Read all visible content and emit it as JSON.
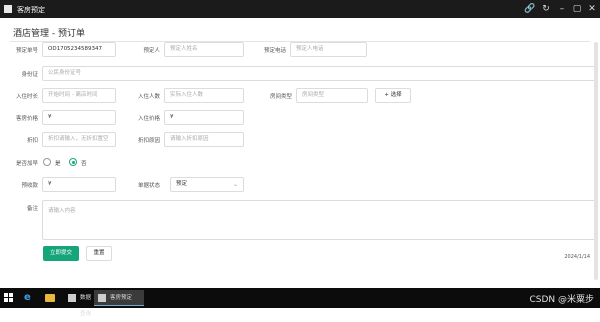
{
  "window": {
    "title": "客房预定",
    "controls": [
      "🔗",
      "↻",
      "–",
      "▢",
      "✕"
    ]
  },
  "page": {
    "title": "酒店管理 - 预订单"
  },
  "form": {
    "booking_no": {
      "label": "预定单号",
      "value": "OD1705234589347"
    },
    "booker": {
      "label": "预定人",
      "placeholder": "预定人姓名"
    },
    "booker_phone": {
      "label": "预定电话",
      "placeholder": "预定人电话"
    },
    "id_card": {
      "label": "身份证",
      "placeholder": "公民身份证号"
    },
    "checkin_time": {
      "label": "入住时长",
      "placeholder": "开始时间 - 离店时间"
    },
    "guests": {
      "label": "入住人数",
      "placeholder": "实际入住人数"
    },
    "room_type": {
      "label": "房间类型",
      "placeholder": "房间类型",
      "select_button": "+ 选择"
    },
    "price": {
      "label": "客房价格",
      "value": "¥"
    },
    "checkin_price": {
      "label": "入住价格",
      "value": "¥"
    },
    "discount": {
      "label": "折扣",
      "placeholder": "折扣请输入，无折扣置空"
    },
    "discount_reason": {
      "label": "折扣原因",
      "placeholder": "请输入折扣原因"
    },
    "breakfast": {
      "label": "是否加早",
      "options": [
        "是",
        "否"
      ],
      "selected": "否"
    },
    "deposit": {
      "label": "预收款",
      "value": "¥"
    },
    "status": {
      "label": "单据状态",
      "value": "预定"
    },
    "remark": {
      "label": "备注",
      "placeholder": "请输入内容"
    }
  },
  "actions": {
    "submit": "立即提交",
    "reset": "重置"
  },
  "clock": {
    "time": "",
    "date": "2024/1/14"
  },
  "taskbar": {
    "apps": [
      {
        "label": "数据查询"
      },
      {
        "label": "客房预定",
        "active": true
      }
    ]
  },
  "watermark": "CSDN @米粟步"
}
